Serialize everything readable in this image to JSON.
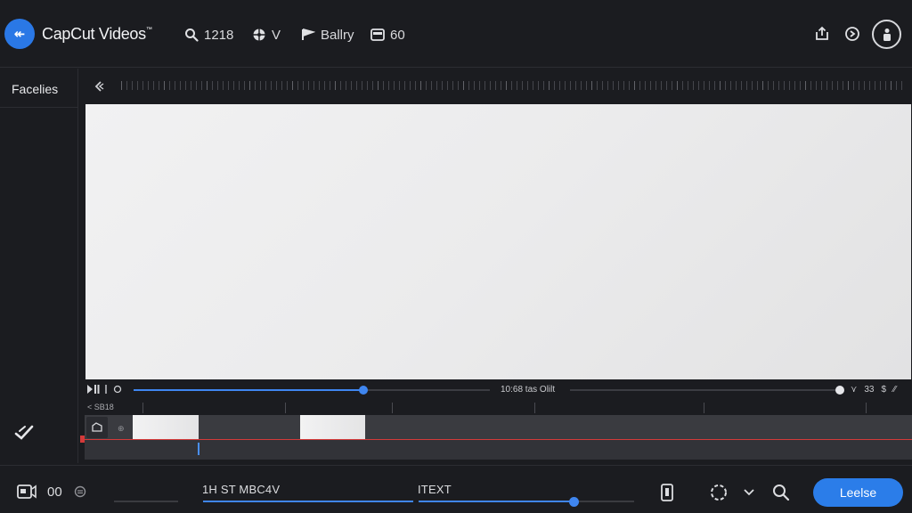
{
  "app": {
    "title": "CapCut Videos",
    "title_mark": "™",
    "logo_glyph": "↞"
  },
  "toolbar": {
    "tools": [
      {
        "icon": "search-icon",
        "label": "1218"
      },
      {
        "icon": "effects-icon",
        "label": "V"
      },
      {
        "icon": "flag-icon",
        "label": "Ballry"
      },
      {
        "icon": "caption-icon",
        "label": "60"
      }
    ]
  },
  "left_panel": {
    "title": "Facelies"
  },
  "playback": {
    "timecode": "10:68 tas Olilt",
    "progress": 0.645,
    "right_controls": [
      "⋎",
      "33",
      "$",
      "⁄⁄"
    ]
  },
  "timeline": {
    "header_label": "< SB18"
  },
  "bottom": {
    "counter": "00",
    "section_a_label": "1H ST MBC4V",
    "section_b_label": "ITEXT",
    "primary_button": "Leelse"
  },
  "colors": {
    "accent": "#2b7de9",
    "playhead": "#d43a3a",
    "background": "#1b1c20"
  }
}
